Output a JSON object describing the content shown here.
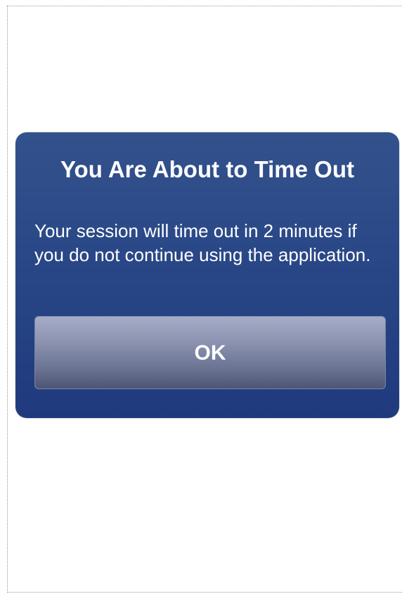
{
  "dialog": {
    "title": "You Are About to Time Out",
    "message": "Your session will time out in 2 minutes if you do not continue using the application.",
    "ok_label": "OK"
  },
  "colors": {
    "dialog_background": "#284686",
    "button_background": "#8c93b1",
    "text": "#ffffff"
  }
}
